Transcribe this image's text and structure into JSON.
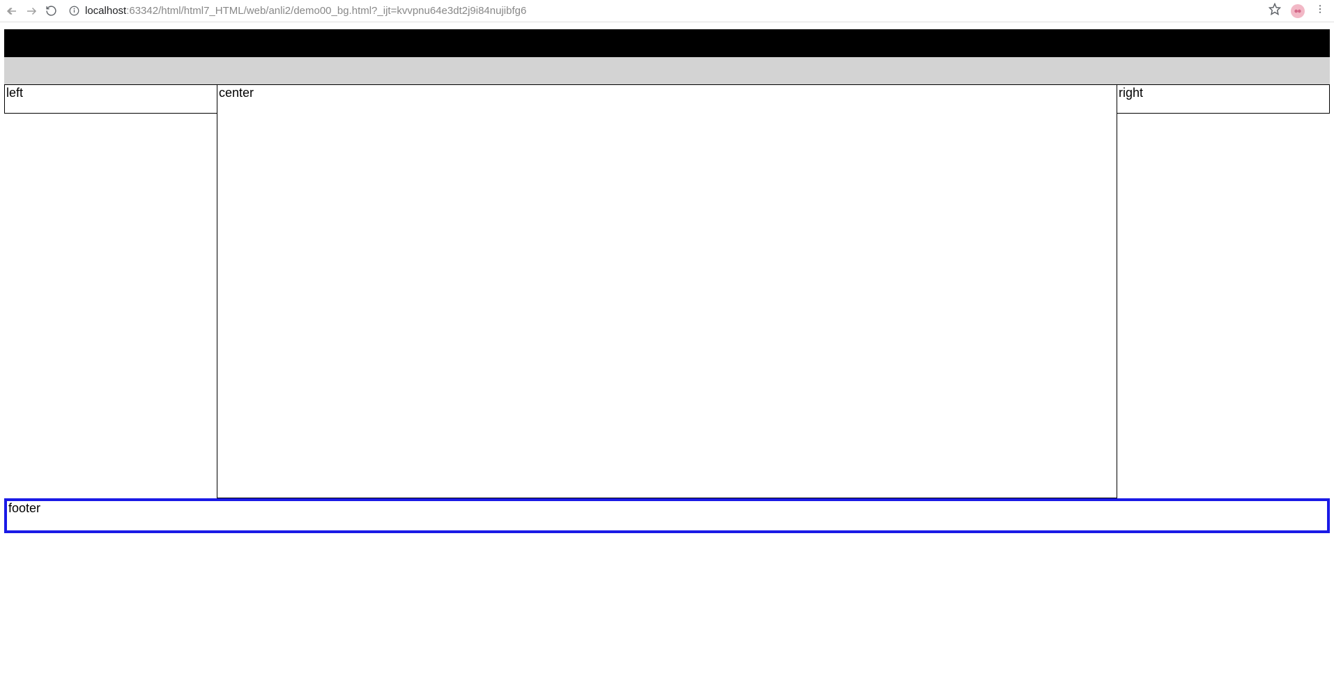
{
  "browser": {
    "url_host": "localhost",
    "url_port_path": ":63342/html/html7_HTML/web/anli2/demo00_bg.html?_ijt=kvvpnu64e3dt2j9i84nujibfg6"
  },
  "layout": {
    "left_label": "left",
    "center_label": "center",
    "right_label": "right",
    "footer_label": "footer"
  }
}
